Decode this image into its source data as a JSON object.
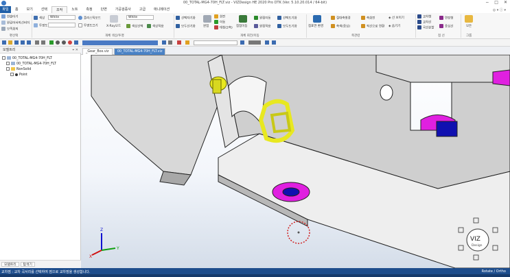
{
  "window": {
    "title": "00_TOTAL-MG4-70H_FLT.viz - VIZDesign HE 2020 Pro DTK (Ver. 5.10.20.014 / 64-bit)",
    "controls": [
      "−",
      "□",
      "✕"
    ]
  },
  "menu": {
    "file_label": "파일",
    "tabs": [
      "홈",
      "보기",
      "선택",
      "조작",
      "노트",
      "측정",
      "단면",
      "가공검증사",
      "고급",
      "애니메이션"
    ],
    "active_tab": "조작",
    "right_text": "◎ ▾ ⓘ ▾"
  },
  "ribbon": {
    "left_items": [
      "현슬더기",
      "원길어서의선비이",
      "모족회의"
    ],
    "left_group": "편선택",
    "color_label": "색상",
    "color_value": "White",
    "transparency_label": "투명도",
    "smooth_label": "플라스틱모드",
    "smooth2_label": "투명도끄기",
    "xray_label": "X-Ray모드",
    "white2_value": "White",
    "sel_color_label": "색상선택",
    "sel_color2_label": "색상적용",
    "group_color": "개체 색상/투명",
    "create_col1": [
      "선택자기화",
      "모두선기화"
    ],
    "create_col2": [
      "원점",
      "회전",
      "이동",
      "대칭(2축)"
    ],
    "create_col3": [
      "점점이동",
      "원점이동",
      "원점적용"
    ],
    "create_col4": [
      "선택도기화",
      "모두도기화"
    ],
    "group_rotate": "개체 회전/이동",
    "mark_labels": [
      "점표연 환경",
      "절대축병경",
      "축색(중심)",
      "축회전",
      "직선으로 연환"
    ],
    "group_axis": "축관련",
    "line_labels": [
      "◈ 선 보이기",
      "◈ 숨기기",
      "교차형",
      "교차선",
      "곡선분할",
      "연장형",
      "중심선"
    ],
    "group_line": "점 선",
    "last_label": "모든",
    "group_last": "그룹"
  },
  "tree": {
    "title": "모델트리",
    "pin_text": "⌖ ✕",
    "rows": [
      {
        "label": "00_TOTAL-MG4-70H_FLT",
        "level": 0
      },
      {
        "label": "00_TOTAL-MG4-70H_FLT",
        "level": 1
      },
      {
        "label": "NonSolid",
        "level": 1
      },
      {
        "label": "Point",
        "level": 2
      }
    ],
    "bottom_tabs": [
      "모델트리",
      "탐색기"
    ]
  },
  "doc_tabs": [
    {
      "label": "_Gear_Box.viz",
      "active": false
    },
    {
      "label": "00_TOTAL-MG4-70H_FLT.viz",
      "active": true
    }
  ],
  "viewport": {
    "point_label": "Point",
    "nav_logo": "VIZ",
    "nav_logo_sub": "Design",
    "axis_labels": [
      "X",
      "Y",
      "Z"
    ]
  },
  "status": {
    "message": "교차점 : 교차 곡서리를 선택하여 점으로 교차점을 생성합니다.",
    "mode": "Rotate / Ortho"
  },
  "colors": {
    "accent": "#1f5fa8",
    "magenta": "#e020e0",
    "blue_part": "#1010b0",
    "yellow_part": "#e8e820",
    "highlight_circle": "#d02020"
  }
}
